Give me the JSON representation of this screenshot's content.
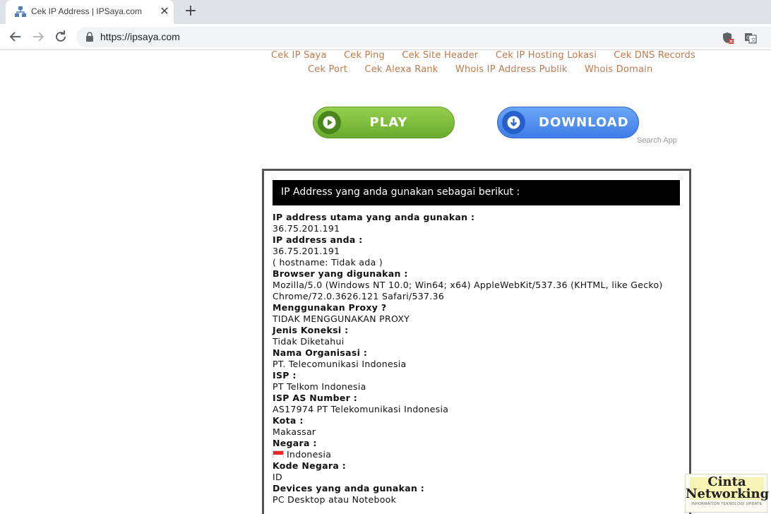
{
  "browser": {
    "tab_title": "Cek IP Address | IPSaya.com",
    "tab_close": "✕",
    "new_tab": "+",
    "url": "https://ipsaya.com"
  },
  "nav": {
    "row1": [
      "Cek IP Saya",
      "Cek Ping",
      "Cek Site Header",
      "Cek IP Hosting Lokasi",
      "Cek DNS Records"
    ],
    "row2": [
      "Cek Port",
      "Cek Alexa Rank",
      "Whois IP Address Publik",
      "Whois Domain"
    ]
  },
  "buttons": {
    "play": "PLAY",
    "download": "DOWNLOAD",
    "search_app": "Search App"
  },
  "info": {
    "header": "IP Address yang anda gunakan sebagai berikut :",
    "fields": [
      {
        "label": "IP address utama yang anda gunakan :",
        "values": [
          "36.75.201.191"
        ]
      },
      {
        "label": "IP address anda :",
        "values": [
          "36.75.201.191",
          "( hostname: Tidak ada )"
        ]
      },
      {
        "label": "Browser yang digunakan :",
        "values": [
          "Mozilla/5.0 (Windows NT 10.0; Win64; x64) AppleWebKit/537.36 (KHTML, like Gecko)",
          "Chrome/72.0.3626.121 Safari/537.36"
        ]
      },
      {
        "label": "Menggunakan Proxy ?",
        "values": [
          "TIDAK MENGGUNAKAN PROXY"
        ]
      },
      {
        "label": "Jenis Koneksi :",
        "values": [
          "Tidak Diketahui"
        ]
      },
      {
        "label": "Nama Organisasi :",
        "values": [
          "PT. Telecomunikasi Indonesia"
        ]
      },
      {
        "label": "ISP :",
        "values": [
          "PT Telkom Indonesia"
        ]
      },
      {
        "label": "ISP AS Number :",
        "values": [
          "AS17974 PT Telekomunikasi Indonesia"
        ]
      },
      {
        "label": "Kota :",
        "values": [
          "Makassar"
        ]
      },
      {
        "label": "Negara :",
        "values": [
          "Indonesia"
        ],
        "flag": true
      },
      {
        "label": "Kode Negara :",
        "values": [
          "ID"
        ]
      },
      {
        "label": "Devices yang anda gunakan :",
        "values": [
          "PC Desktop atau Notebook"
        ]
      }
    ]
  },
  "watermark": {
    "line1": "Cinta",
    "line2": "Networking",
    "tagline": "INFORMATION TEKNOLOGI UPDATE"
  }
}
